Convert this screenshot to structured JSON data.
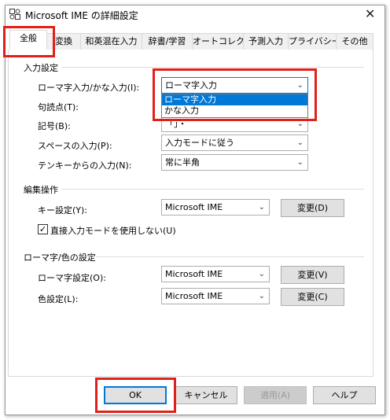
{
  "window": {
    "title": "Microsoft IME の詳細設定",
    "close_glyph": "✕"
  },
  "tabs": [
    {
      "label": "全般",
      "active": true
    },
    {
      "label": "変換"
    },
    {
      "label": "和英混在入力"
    },
    {
      "label": "辞書/学習"
    },
    {
      "label": "オートコレクト"
    },
    {
      "label": "予測入力"
    },
    {
      "label": "プライバシー"
    },
    {
      "label": "その他"
    }
  ],
  "input_settings": {
    "title": "入力設定",
    "romaji_kana": {
      "label": "ローマ字入力/かな入力(I):",
      "value": "ローマ字入力"
    },
    "dropdown_options": [
      "ローマ字入力",
      "かな入力"
    ],
    "punctuation": {
      "label": "句読点(T):",
      "value": ""
    },
    "symbol": {
      "label": "記号(B):",
      "value": "「」・"
    },
    "space": {
      "label": "スペースの入力(P):",
      "value": "入力モードに従う"
    },
    "tenkey": {
      "label": "テンキーからの入力(N):",
      "value": "常に半角"
    }
  },
  "edit_ops": {
    "title": "編集操作",
    "key_setting": {
      "label": "キー設定(Y):",
      "value": "Microsoft IME",
      "button": "変更(D)"
    },
    "direct_input": {
      "label": "直接入力モードを使用しない(U)",
      "checked": true,
      "check_glyph": "✓"
    }
  },
  "romaji_color": {
    "title": "ローマ字/色の設定",
    "romaji": {
      "label": "ローマ字設定(O):",
      "value": "Microsoft IME",
      "button": "変更(V)"
    },
    "color": {
      "label": "色設定(L):",
      "value": "Microsoft IME",
      "button": "変更(C)"
    }
  },
  "footer": {
    "ok": "OK",
    "cancel": "キャンセル",
    "apply": "適用(A)",
    "help": "ヘルプ"
  },
  "glyphs": {
    "caret": "⌄"
  },
  "colors": {
    "accent": "#0078d7",
    "callout": "#e0201a"
  }
}
